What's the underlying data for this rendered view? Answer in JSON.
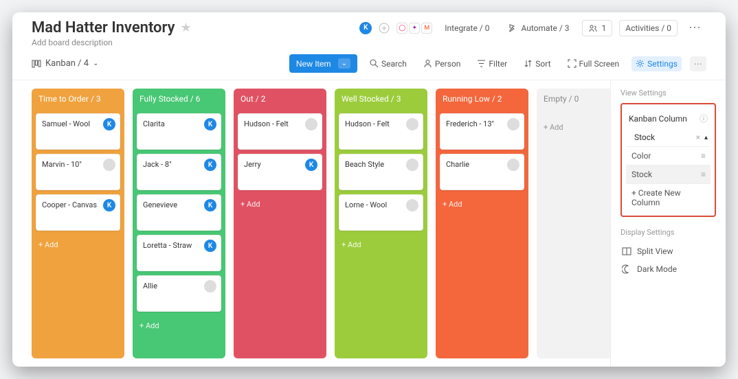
{
  "header": {
    "title": "Mad Hatter Inventory",
    "description": "Add board description",
    "integrate_label": "Integrate / 0",
    "automate_label": "Automate / 3",
    "members_label": "1",
    "activities_label": "Activities / 0"
  },
  "toolbar": {
    "view_label": "Kanban / 4",
    "new_item": "New Item",
    "search": "Search",
    "person": "Person",
    "filter": "Filter",
    "sort": "Sort",
    "fullscreen": "Full Screen",
    "settings": "Settings"
  },
  "lanes": [
    {
      "title": "Time to Order / 3",
      "color": "#f0a23e",
      "cards": [
        {
          "label": "Samuel - Wool",
          "badge": "K",
          "badgeColor": "#1e88e5"
        },
        {
          "label": "Marvin - 10\"",
          "avatar": "img"
        },
        {
          "label": "Cooper - Canvas",
          "badge": "K",
          "badgeColor": "#1e88e5"
        }
      ],
      "add": "+ Add"
    },
    {
      "title": "Fully Stocked / 6",
      "color": "#48c774",
      "cards": [
        {
          "label": "Clarita",
          "badge": "K",
          "badgeColor": "#1e88e5"
        },
        {
          "label": "Jack - 8\"",
          "badge": "K",
          "badgeColor": "#1e88e5"
        },
        {
          "label": "Genevieve",
          "badge": "K",
          "badgeColor": "#1e88e5"
        },
        {
          "label": "Loretta - Straw",
          "badge": "K",
          "badgeColor": "#1e88e5"
        },
        {
          "label": "Allie",
          "avatar": "img"
        }
      ],
      "add": "+ Add"
    },
    {
      "title": "Out / 2",
      "color": "#e05263",
      "cards": [
        {
          "label": "Hudson - Felt",
          "avatar": "img"
        },
        {
          "label": "Jerry",
          "badge": "K",
          "badgeColor": "#1e88e5"
        }
      ],
      "add": "+ Add"
    },
    {
      "title": "Well Stocked / 3",
      "color": "#9ccc3c",
      "cards": [
        {
          "label": "Hudson - Felt",
          "avatar": "img"
        },
        {
          "label": "Beach Style",
          "avatar": "img"
        },
        {
          "label": "Lorne - Wool",
          "avatar": "img"
        }
      ],
      "add": "+ Add"
    },
    {
      "title": "Running Low / 2",
      "color": "#f4663c",
      "cards": [
        {
          "label": "Frederich - 13\"",
          "avatar": "img"
        },
        {
          "label": "Charlie",
          "avatar": "img"
        }
      ],
      "add": "+ Add"
    },
    {
      "title": "Empty / 0",
      "color": "empty",
      "cards": [],
      "add": "+ Add"
    }
  ],
  "sidebar": {
    "view_settings": "View Settings",
    "kanban_column": "Kanban Column",
    "selected": "Stock",
    "options": [
      {
        "label": "Color",
        "icon": "drag"
      },
      {
        "label": "Stock",
        "icon": "drag",
        "hl": true
      }
    ],
    "create_new": "+ Create New Column",
    "display_settings": "Display Settings",
    "split_view": "Split View",
    "dark_mode": "Dark Mode"
  }
}
